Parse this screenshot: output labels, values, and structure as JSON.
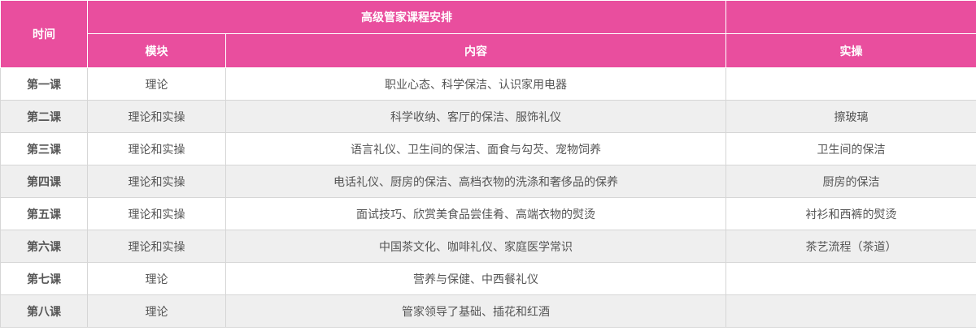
{
  "colors": {
    "header_bg": "#e94e9e",
    "alt_row_bg": "#efefef"
  },
  "table": {
    "header": {
      "time": "时间",
      "course_title": "高级管家课程安排",
      "module": "模块",
      "content": "内容",
      "practice": "实操"
    },
    "rows": [
      {
        "lesson": "第一课",
        "module": "理论",
        "content": "职业心态、科学保洁、认识家用电器",
        "practice": ""
      },
      {
        "lesson": "第二课",
        "module": "理论和实操",
        "content": "科学收纳、客厅的保洁、服饰礼仪",
        "practice": "擦玻璃"
      },
      {
        "lesson": "第三课",
        "module": "理论和实操",
        "content": "语言礼仪、卫生间的保洁、面食与勾芡、宠物饲养",
        "practice": "卫生间的保洁"
      },
      {
        "lesson": "第四课",
        "module": "理论和实操",
        "content": "电话礼仪、厨房的保洁、高档衣物的洗涤和奢侈品的保养",
        "practice": "厨房的保洁"
      },
      {
        "lesson": "第五课",
        "module": "理论和实操",
        "content": "面试技巧、欣赏美食品尝佳肴、高端衣物的熨烫",
        "practice": "衬衫和西裤的熨烫"
      },
      {
        "lesson": "第六课",
        "module": "理论和实操",
        "content": "中国茶文化、咖啡礼仪、家庭医学常识",
        "practice": "茶艺流程（茶道）"
      },
      {
        "lesson": "第七课",
        "module": "理论",
        "content": "营养与保健、中西餐礼仪",
        "practice": ""
      },
      {
        "lesson": "第八课",
        "module": "理论",
        "content": "管家领导了基础、插花和红酒",
        "practice": ""
      }
    ]
  }
}
